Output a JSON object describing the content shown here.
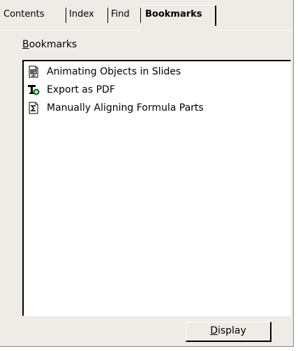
{
  "tabs": [
    {
      "label": "Contents",
      "active": false
    },
    {
      "label": "Index",
      "active": false
    },
    {
      "label": "Find",
      "active": false
    },
    {
      "label": "Bookmarks",
      "active": true
    }
  ],
  "bookmarks_label": {
    "mnemonic": "B",
    "rest": "ookmarks"
  },
  "bookmarks": [
    {
      "label": "Animating Objects in Slides",
      "icon": "presentation-doc-icon"
    },
    {
      "label": "Export as PDF",
      "icon": "text-doc-icon"
    },
    {
      "label": "Manually Aligning Formula Parts",
      "icon": "formula-doc-icon"
    }
  ],
  "display_button": {
    "mnemonic": "D",
    "rest": "isplay"
  }
}
